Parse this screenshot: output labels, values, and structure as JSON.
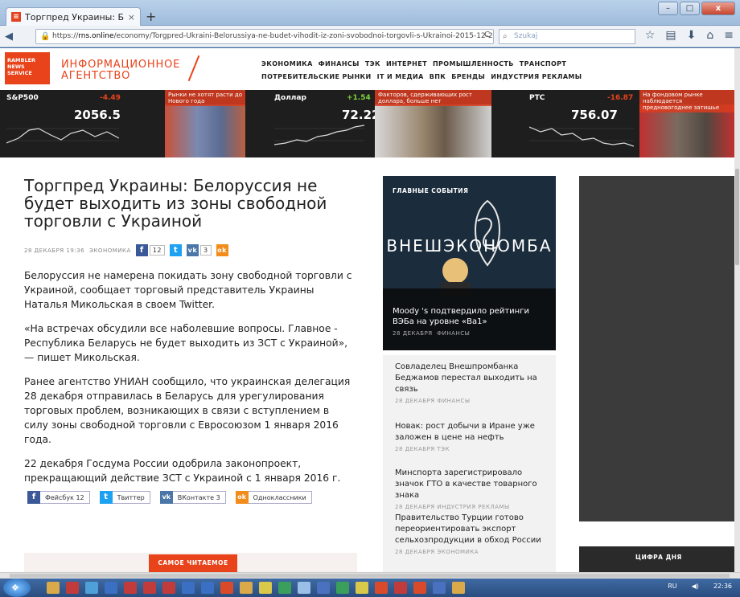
{
  "browser": {
    "tab_title": "Торгпред Украины: Бело...",
    "tab_close": "×",
    "new_tab": "+",
    "url_prefix": "https://",
    "url_domain": "rns.online",
    "url_path": "/economy/Torgpred-Ukraini-Belorussiya-ne-budet-vihodit-iz-zoni-svobodnoi-torgovli-s-Ukrainoi-2015-12-28/",
    "reload": "C",
    "search_placeholder": "Szukaj",
    "window_buttons": [
      "–",
      "□",
      "x"
    ]
  },
  "site": {
    "logo_line1": "RAMBLER",
    "logo_line2": "NEWS",
    "logo_line3": "SERVICE",
    "agency_line1": "ИНФОРМАЦИОННОЕ",
    "agency_line2": "АГЕНТСТВО",
    "rubrics_row1": [
      "ЭКОНОМИКА",
      "ФИНАНСЫ",
      "ТЭК",
      "ИНТЕРНЕТ",
      "ПРОМЫШЛЕННОСТЬ",
      "ТРАНСПОРТ"
    ],
    "rubrics_row2": [
      "ПОТРЕБИТЕЛЬСКИЕ РЫНКИ",
      "IT И МЕДИА",
      "ВПК",
      "БРЕНДЫ",
      "ИНДУСТРИЯ РЕКЛАМЫ"
    ]
  },
  "ticker": [
    {
      "name": "S&P500",
      "change": "-4.49",
      "value": "2056.5",
      "color": "#e8431b",
      "news": "Рынки не хотят расти до Нового года"
    },
    {
      "name": "Доллар",
      "change": "+1.54",
      "value": "72.224",
      "color": "#7dd13a",
      "news": "Факторов, сдерживающих рост доллара, больше нет"
    },
    {
      "name": "РТС",
      "change": "-16.87",
      "value": "756.07",
      "color": "#e8431b",
      "news": "На фондовом рынке наблюдается предновогоднее затишье"
    }
  ],
  "article": {
    "title": "Торгпред Украины: Белоруссия не будет выходить из зоны свободной торговли с Украиной",
    "date": "28 ДЕКАБРЯ 19:36",
    "rubric": "ЭКОНОМИКА",
    "fb_count": "12",
    "vk_count": "3",
    "paragraphs": [
      "Белоруссия не намерена покидать зону свободной торговли с Украиной, сообщает торговый представитель Украины Наталья Микольская в своем Twitter.",
      "«На встречах обсудили все наболевшие вопросы. Главное - Республика Беларусь не будет выходить из ЗСТ с Украиной», — пишет Микольская.",
      "Ранее агентство УНИАН сообщило, что украинская делегация 28 декабря отправилась в Беларусь для урегулирования торговых проблем, возникающих в связи с вступлением в силу зоны свободной торговли с Евросоюзом 1 января 2016 года.",
      "22 декабря Госдума России одобрила законопроект, прекращающий действие ЗСТ с Украиной с 1 января 2016 г."
    ],
    "share_buttons": [
      {
        "label": "Фейсбук 12",
        "color": "#3b5998",
        "glyph": "f"
      },
      {
        "label": "Твиттер",
        "color": "#1da1f2",
        "glyph": "t"
      },
      {
        "label": "ВКонтакте 3",
        "color": "#4a76a8",
        "glyph": "vk"
      },
      {
        "label": "Одноклассники",
        "color": "#f28c1b",
        "glyph": "ok"
      }
    ],
    "popular_label": "САМОЕ ЧИТАЕМОЕ"
  },
  "main_events": {
    "label": "ГЛАВНЫЕ СОБЫТИЯ",
    "photo_text": "ВНЕШЭКОНОМБА",
    "title": "Moody 's подтвердило рейтинги ВЭБа на уровне «Ba1»",
    "date": "28 ДЕКАБРЯ",
    "rubric": "ФИНАНСЫ"
  },
  "feed": [
    {
      "title": "Совладелец Внешпромбанка Беджамов перестал выходить на связь",
      "meta": "28 ДЕКАБРЯ  ФИНАНСЫ"
    },
    {
      "title": "Новак: рост добычи в Иране уже заложен в цене на нефть",
      "meta": "28 ДЕКАБРЯ  ТЭК"
    },
    {
      "title": "Минспорта зарегистрировало значок ГТО в качестве товарного знака",
      "meta": "28 ДЕКАБРЯ  ИНДУСТРИЯ РЕКЛАМЫ"
    },
    {
      "title": "Правительство Турции готово переориентировать экспорт сельхозпродукции в обход России",
      "meta": "28 ДЕКАБРЯ  ЭКОНОМИКА"
    }
  ],
  "right": {
    "digit_label": "ЦИФРА ДНЯ"
  },
  "taskbar": {
    "lang": "RU",
    "time": "22:36"
  }
}
